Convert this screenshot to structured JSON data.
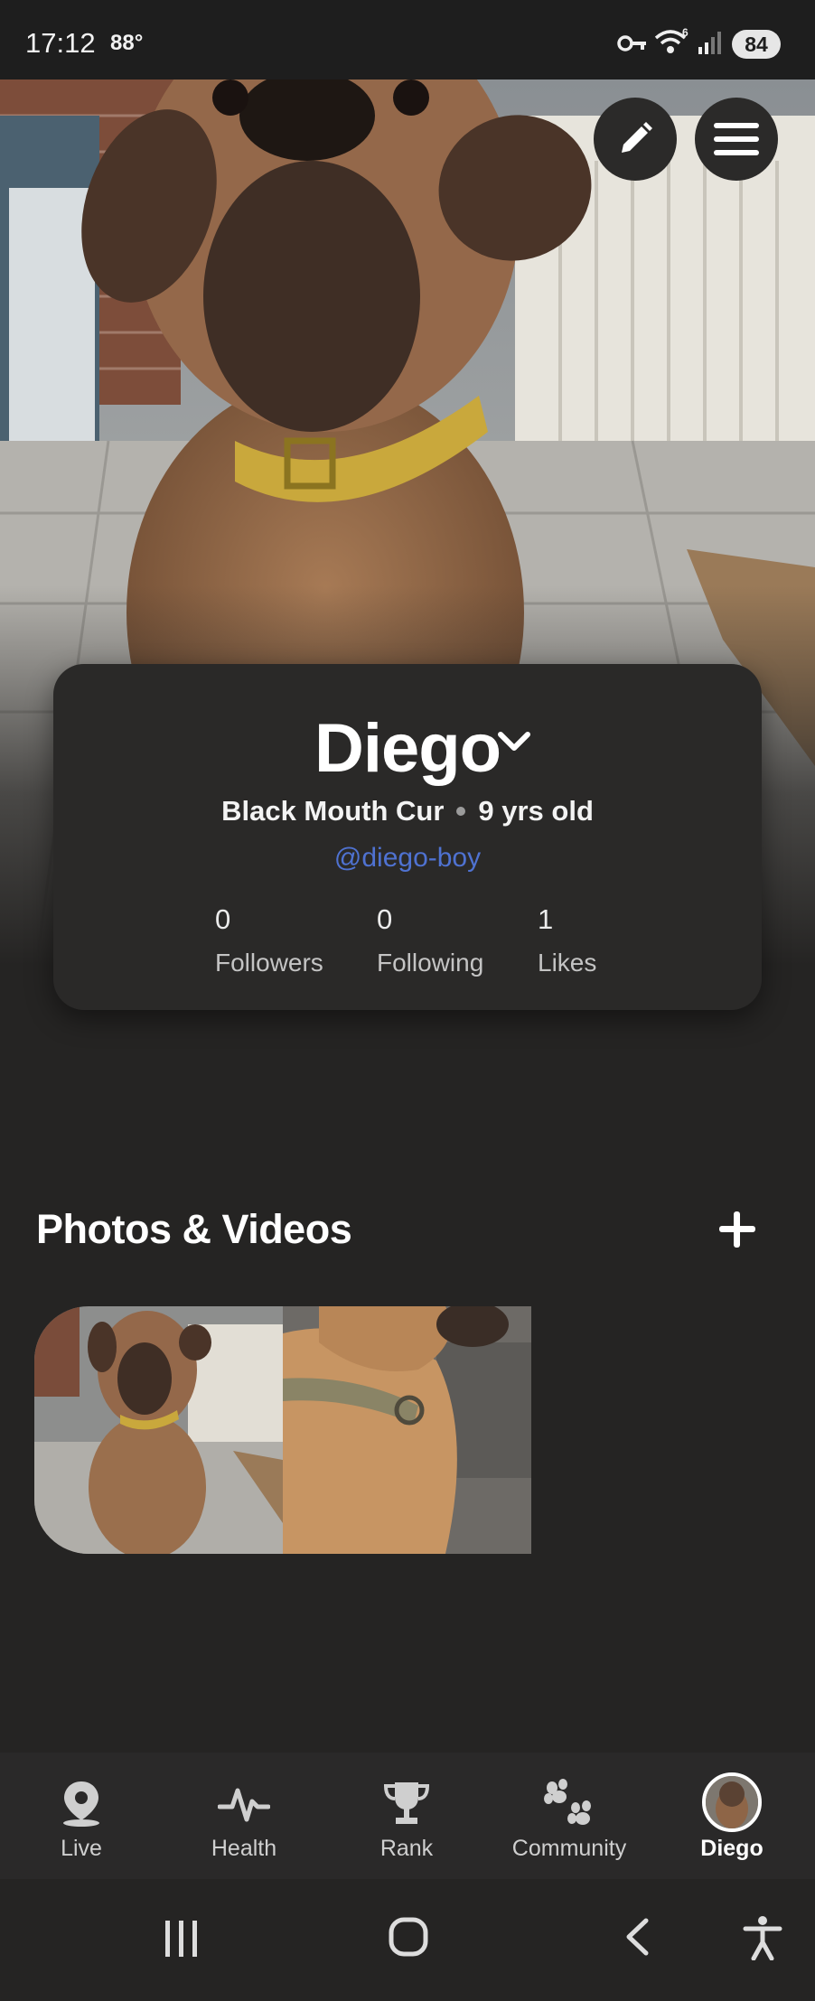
{
  "status_bar": {
    "time": "17:12",
    "temperature": "88°",
    "battery": "84",
    "icons": [
      "key-icon",
      "wifi-icon",
      "signal-icon"
    ]
  },
  "header": {
    "edit_icon": "pencil-icon",
    "menu_icon": "hamburger-menu-icon"
  },
  "profile": {
    "name": "Diego",
    "breed": "Black Mouth Cur",
    "age": "9 yrs old",
    "handle": "@diego-boy",
    "stats": [
      {
        "value": "0",
        "label": "Followers"
      },
      {
        "value": "0",
        "label": "Following"
      },
      {
        "value": "1",
        "label": "Likes"
      }
    ]
  },
  "media": {
    "title": "Photos & Videos",
    "add_icon": "plus-icon",
    "thumbnails": [
      "dog-sitting-photo",
      "dog-lying-photo"
    ]
  },
  "bottom_nav": [
    {
      "label": "Live",
      "icon": "location-pin-icon",
      "active": false
    },
    {
      "label": "Health",
      "icon": "pulse-icon",
      "active": false
    },
    {
      "label": "Rank",
      "icon": "trophy-icon",
      "active": false
    },
    {
      "label": "Community",
      "icon": "paw-icon",
      "active": false
    },
    {
      "label": "Diego",
      "icon": "avatar",
      "active": true
    }
  ],
  "system_nav": [
    "recents-icon",
    "home-icon",
    "back-icon",
    "accessibility-icon"
  ],
  "colors": {
    "background": "#252423",
    "card": "#2a2928",
    "handle": "#4f72d1",
    "active_text": "#ffffff"
  }
}
